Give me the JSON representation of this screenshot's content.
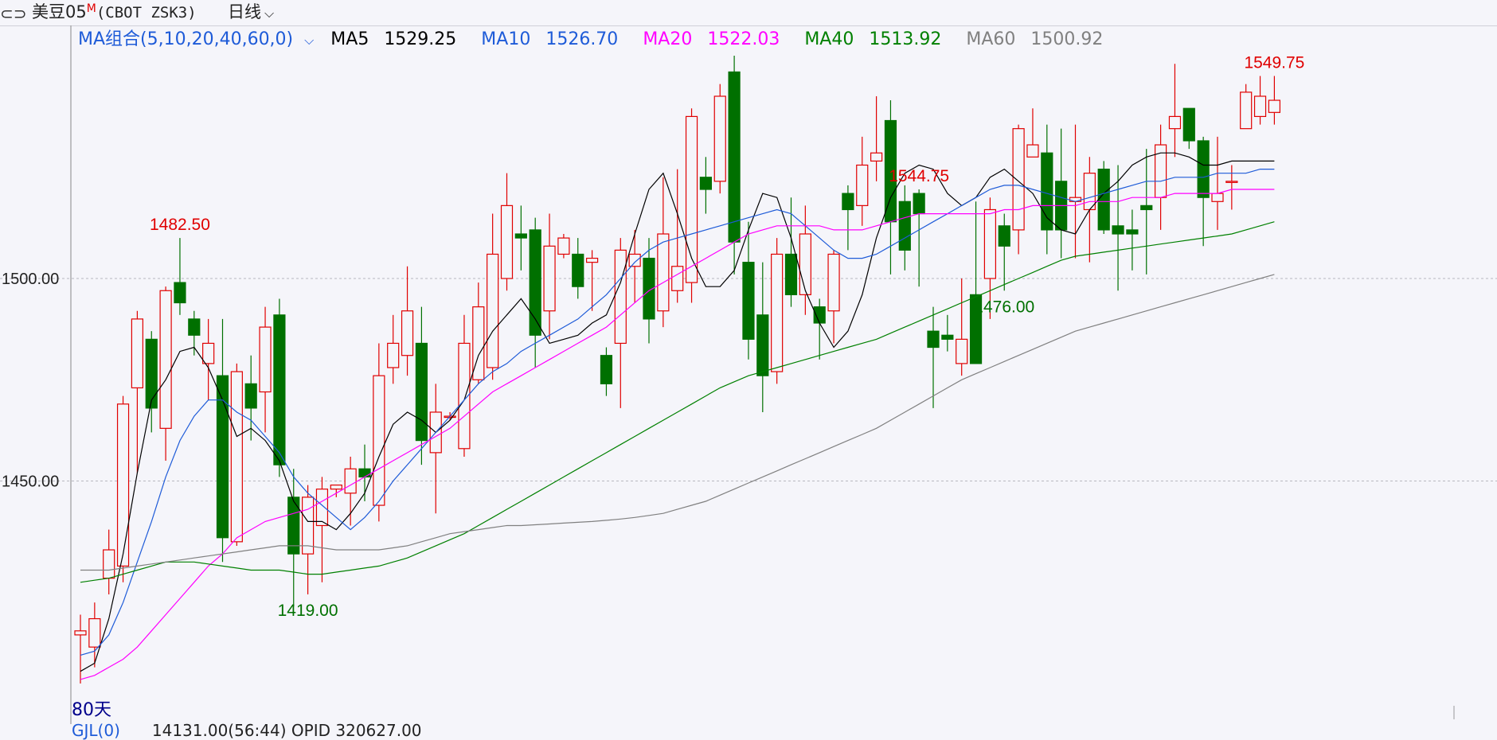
{
  "topbar": {
    "link_icon": "link-icon",
    "symbol": "美豆05",
    "symbol_sup": "M",
    "exchange": "(CBOT ZSK3)",
    "period": "日线",
    "dropdown_icon": "chevron-down-icon"
  },
  "ma_legend": {
    "combo_label": "MA组合(5,10,20,40,60,0)",
    "items": [
      {
        "label": "MA5",
        "value": "1529.25",
        "color": "#000000"
      },
      {
        "label": "MA10",
        "value": "1526.70",
        "color": "#1e5bd8"
      },
      {
        "label": "MA20",
        "value": "1522.03",
        "color": "#ff00ff"
      },
      {
        "label": "MA40",
        "value": "1513.92",
        "color": "#008000"
      },
      {
        "label": "MA60",
        "value": "1500.92",
        "color": "#808080"
      }
    ]
  },
  "range_label": "80天",
  "bottom_partial": {
    "indicator": "GJL(0)",
    "values": "14131.00(56:44)    OPID 320627.00"
  },
  "chart_data": {
    "type": "candlestick",
    "colors": {
      "up": "#e00000",
      "down": "#007000",
      "grid": "#b8b8c0",
      "axis": "#888888"
    },
    "y_ticks": [
      {
        "value": 1500,
        "label": "1500.00"
      },
      {
        "value": 1450,
        "label": "1450.00"
      }
    ],
    "annotations": [
      {
        "label": "1482.50",
        "index": 7,
        "kind": "high"
      },
      {
        "label": "1419.00",
        "index": 16,
        "kind": "low"
      },
      {
        "label": "1544.75",
        "index": 59,
        "kind": "high"
      },
      {
        "label": "1476.00",
        "index": 65,
        "kind": "low"
      },
      {
        "label": "1549.75",
        "index": 84,
        "kind": "high"
      }
    ],
    "candles": [
      [
        1412,
        1413,
        1417,
        1400
      ],
      [
        1409,
        1416,
        1420,
        1404
      ],
      [
        1426,
        1433,
        1438,
        1422
      ],
      [
        1429,
        1469,
        1471,
        1425
      ],
      [
        1473,
        1490,
        1492,
        1452
      ],
      [
        1485,
        1468,
        1487,
        1462
      ],
      [
        1463,
        1497,
        1498,
        1455
      ],
      [
        1499,
        1494,
        1510,
        1491
      ],
      [
        1490,
        1486,
        1492,
        1481
      ],
      [
        1479,
        1484,
        1490,
        1470
      ],
      [
        1476,
        1436,
        1490,
        1430
      ],
      [
        1435,
        1477,
        1479,
        1434
      ],
      [
        1474,
        1468,
        1481,
        1460
      ],
      [
        1472,
        1488,
        1493,
        1462
      ],
      [
        1491,
        1454,
        1495,
        1451
      ],
      [
        1446,
        1432,
        1453,
        1419
      ],
      [
        1432,
        1446,
        1449,
        1422
      ],
      [
        1439,
        1448,
        1451,
        1425
      ],
      [
        1448,
        1449,
        1449,
        1446
      ],
      [
        1447,
        1453,
        1456,
        1439
      ],
      [
        1453,
        1451,
        1459,
        1445
      ],
      [
        1444,
        1476,
        1484,
        1440
      ],
      [
        1478,
        1484,
        1491,
        1474
      ],
      [
        1481,
        1492,
        1503,
        1476
      ],
      [
        1484,
        1460,
        1493,
        1454
      ],
      [
        1457,
        1467,
        1474,
        1442
      ],
      [
        1466,
        1466,
        1467,
        1465
      ],
      [
        1458,
        1484,
        1491,
        1456
      ],
      [
        1475,
        1493,
        1499,
        1474
      ],
      [
        1478,
        1506,
        1516,
        1475
      ],
      [
        1500,
        1518,
        1526,
        1497
      ],
      [
        1511,
        1510,
        1518,
        1502
      ],
      [
        1512,
        1486,
        1515,
        1478
      ],
      [
        1492,
        1508,
        1516,
        1485
      ],
      [
        1506,
        1510,
        1511,
        1505
      ],
      [
        1506,
        1498,
        1510,
        1495
      ],
      [
        1504,
        1505,
        1507,
        1492
      ],
      [
        1481,
        1474,
        1483,
        1471
      ],
      [
        1484,
        1507,
        1510,
        1468
      ],
      [
        1503,
        1506,
        1512,
        1494
      ],
      [
        1505,
        1490,
        1510,
        1484
      ],
      [
        1492,
        1511,
        1525,
        1488
      ],
      [
        1497,
        1503,
        1527,
        1494
      ],
      [
        1499,
        1540,
        1542,
        1494
      ],
      [
        1525,
        1522,
        1530,
        1516
      ],
      [
        1524,
        1545,
        1548,
        1521
      ],
      [
        1551,
        1509,
        1555,
        1501
      ],
      [
        1504,
        1485,
        1514,
        1480
      ],
      [
        1491,
        1476,
        1504,
        1467
      ],
      [
        1477,
        1506,
        1510,
        1474
      ],
      [
        1506,
        1496,
        1520,
        1493
      ],
      [
        1496,
        1511,
        1518,
        1491
      ],
      [
        1493,
        1489,
        1495,
        1480
      ],
      [
        1492,
        1506,
        1507,
        1484
      ],
      [
        1521,
        1517,
        1523,
        1507
      ],
      [
        1518,
        1528,
        1535,
        1513
      ],
      [
        1529,
        1531,
        1545,
        1524
      ],
      [
        1539,
        1514,
        1544,
        1501
      ],
      [
        1519,
        1507,
        1523,
        1502
      ],
      [
        1521,
        1516,
        1522,
        1498
      ],
      [
        1487,
        1483,
        1493,
        1468
      ],
      [
        1486,
        1485,
        1491,
        1482
      ],
      [
        1479,
        1485,
        1500,
        1476
      ],
      [
        1496,
        1479,
        1519,
        1485
      ],
      [
        1500,
        1517,
        1520,
        1490
      ],
      [
        1513,
        1508,
        1516,
        1497
      ],
      [
        1512,
        1537,
        1538,
        1506
      ],
      [
        1530,
        1533,
        1542,
        1531
      ],
      [
        1531,
        1512,
        1538,
        1506
      ],
      [
        1524,
        1512,
        1537,
        1505
      ],
      [
        1519,
        1520,
        1538,
        1505
      ],
      [
        1517,
        1526,
        1530,
        1504
      ],
      [
        1527,
        1512,
        1529,
        1511
      ],
      [
        1513,
        1511,
        1528,
        1497
      ],
      [
        1512,
        1511,
        1517,
        1502
      ],
      [
        1518,
        1517,
        1532,
        1501
      ],
      [
        1520,
        1533,
        1538,
        1512
      ],
      [
        1537,
        1540,
        1553,
        1530
      ],
      [
        1542,
        1534,
        1542,
        1532
      ],
      [
        1534,
        1520,
        1535,
        1508
      ],
      [
        1519,
        1521,
        1535,
        1512
      ],
      [
        1524,
        1524,
        1528,
        1517
      ],
      [
        1537,
        1546,
        1548,
        1540
      ],
      [
        1540,
        1545,
        1550,
        1538
      ],
      [
        1541,
        1544,
        1550,
        1538
      ]
    ],
    "ma_series": [
      {
        "name": "MA5",
        "color": "#000000",
        "values": [
          1403,
          1405,
          1416,
          1432,
          1452,
          1470,
          1475,
          1482,
          1483,
          1478,
          1470,
          1461,
          1463,
          1460,
          1455,
          1445,
          1440,
          1440,
          1438,
          1442,
          1447,
          1456,
          1464,
          1467,
          1465,
          1462,
          1465,
          1470,
          1481,
          1487,
          1491,
          1495,
          1490,
          1484,
          1485,
          1486,
          1489,
          1491,
          1499,
          1511,
          1522,
          1526,
          1516,
          1505,
          1498,
          1498,
          1502,
          1512,
          1521,
          1520,
          1510,
          1497,
          1489,
          1483,
          1487,
          1496,
          1510,
          1520,
          1526,
          1528,
          1527,
          1521,
          1518,
          1520,
          1525,
          1527,
          1524,
          1521,
          1515,
          1512,
          1511,
          1517,
          1521,
          1524,
          1528,
          1530,
          1531,
          1531,
          1530,
          1528,
          1528,
          1529,
          1529,
          1529,
          1529
        ]
      },
      {
        "name": "MA10",
        "color": "#1e5bd8",
        "values": [
          1407,
          1408,
          1412,
          1420,
          1430,
          1440,
          1451,
          1460,
          1466,
          1470,
          1470,
          1467,
          1465,
          1461,
          1457,
          1451,
          1447,
          1444,
          1441,
          1438,
          1441,
          1445,
          1450,
          1454,
          1458,
          1462,
          1466,
          1470,
          1474,
          1477,
          1479,
          1482,
          1484,
          1486,
          1488,
          1490,
          1493,
          1496,
          1500,
          1504,
          1507,
          1509,
          1510,
          1511,
          1512,
          1513,
          1514,
          1515,
          1516,
          1517,
          1516,
          1513,
          1510,
          1507,
          1505,
          1505,
          1506,
          1508,
          1510,
          1512,
          1514,
          1516,
          1518,
          1520,
          1522,
          1523,
          1523,
          1522,
          1521,
          1520,
          1519,
          1520,
          1521,
          1522,
          1523,
          1524,
          1524,
          1525,
          1525,
          1525,
          1526,
          1526,
          1526,
          1527,
          1527
        ]
      },
      {
        "name": "MA20",
        "color": "#ff00ff",
        "values": [
          1401,
          1402,
          1404,
          1406,
          1409,
          1413,
          1417,
          1421,
          1425,
          1429,
          1432,
          1436,
          1438,
          1440,
          1441,
          1442,
          1443,
          1445,
          1447,
          1449,
          1451,
          1453,
          1455,
          1457,
          1459,
          1461,
          1463,
          1466,
          1469,
          1472,
          1474,
          1476,
          1478,
          1480,
          1482,
          1484,
          1486,
          1488,
          1491,
          1494,
          1497,
          1499,
          1501,
          1503,
          1505,
          1507,
          1509,
          1511,
          1512,
          1513,
          1513,
          1513,
          1513,
          1512,
          1512,
          1512,
          1513,
          1514,
          1515,
          1516,
          1516,
          1516,
          1516,
          1516,
          1516,
          1517,
          1517,
          1518,
          1518,
          1518,
          1518,
          1519,
          1519,
          1519,
          1520,
          1520,
          1520,
          1521,
          1521,
          1521,
          1521,
          1522,
          1522,
          1522,
          1522
        ]
      },
      {
        "name": "MA40",
        "color": "#008000",
        "values": [
          1425,
          1425.5,
          1426,
          1427,
          1428,
          1429,
          1430,
          1430,
          1430,
          1429.5,
          1429,
          1428.5,
          1428,
          1428,
          1428,
          1427.5,
          1427,
          1427,
          1427.5,
          1428,
          1428.5,
          1429,
          1430,
          1431,
          1432.5,
          1434,
          1435.5,
          1437,
          1439,
          1441,
          1443,
          1445,
          1447,
          1449,
          1451,
          1453,
          1455,
          1457,
          1459,
          1461,
          1463,
          1465,
          1467,
          1469,
          1471,
          1473,
          1474.5,
          1476,
          1477,
          1478,
          1479,
          1480,
          1481,
          1482,
          1483,
          1484,
          1485,
          1486.5,
          1488,
          1489.5,
          1491,
          1492.5,
          1494,
          1495.5,
          1497,
          1498.5,
          1500,
          1501.5,
          1503,
          1504.5,
          1505.5,
          1506,
          1506.5,
          1507,
          1507.5,
          1508,
          1508.5,
          1509,
          1509.5,
          1510,
          1510.5,
          1511,
          1512,
          1513,
          1514
        ]
      },
      {
        "name": "MA60",
        "color": "#808080",
        "values": [
          1428,
          1428,
          1428,
          1428.5,
          1429,
          1429.5,
          1430,
          1430.5,
          1431,
          1431.5,
          1432,
          1432.5,
          1433,
          1433.5,
          1434,
          1434,
          1434,
          1433.5,
          1433,
          1433,
          1433,
          1433,
          1433.5,
          1434,
          1435,
          1436,
          1437,
          1437.5,
          1438,
          1438.5,
          1439,
          1439,
          1439.2,
          1439.4,
          1439.6,
          1439.8,
          1440,
          1440.3,
          1440.6,
          1441,
          1441.5,
          1442,
          1443,
          1444,
          1445,
          1446.5,
          1448,
          1449.5,
          1451,
          1452.5,
          1454,
          1455.5,
          1457,
          1458.5,
          1460,
          1461.5,
          1463,
          1465,
          1467,
          1469,
          1471,
          1473,
          1475,
          1476.5,
          1478,
          1479.5,
          1481,
          1482.5,
          1484,
          1485.5,
          1487,
          1488,
          1489,
          1490,
          1491,
          1492,
          1493,
          1494,
          1495,
          1496,
          1497,
          1498,
          1499,
          1500,
          1501
        ]
      }
    ]
  }
}
